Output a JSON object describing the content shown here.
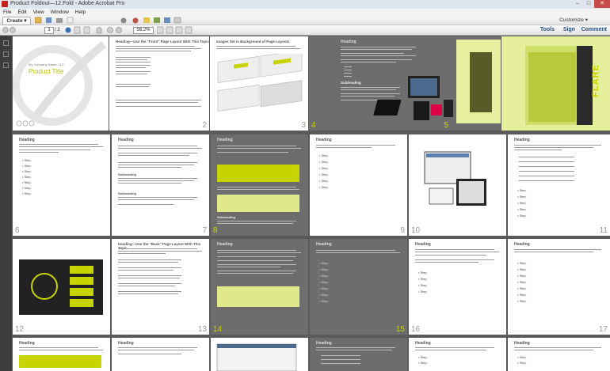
{
  "window": {
    "title": "Product Foldout—12.Fold - Adobe Acrobat Pro",
    "controls": [
      "–",
      "□",
      "✕"
    ]
  },
  "menu": [
    "File",
    "Edit",
    "View",
    "Window",
    "Help"
  ],
  "toolbar": {
    "create_label": "Create",
    "customize_label": "Customize",
    "current_page": "1",
    "total_pages": "/ 2",
    "zoom": "56.2%"
  },
  "right_panel_links": [
    "Tools",
    "Sign",
    "Comment"
  ],
  "pages": {
    "p1": {
      "company": "My Company Name, LLC",
      "product": "Product Title"
    },
    "p2": {
      "heading": "Heading—Use the \"Front\" Page Layout With This Topic",
      "num": "2"
    },
    "p3": {
      "heading": "Images Set in Background of Page Layouts",
      "num": "3"
    },
    "p4": {
      "heading": "Heading",
      "sub": "Subheading",
      "num": "4"
    },
    "p5": {
      "brand": "FLARE",
      "num": "5"
    },
    "p6": {
      "heading": "Heading",
      "num": "6"
    },
    "p7": {
      "heading": "Heading",
      "sub1": "Subheading",
      "sub2": "Subheading",
      "num": "7"
    },
    "p8": {
      "heading": "Heading",
      "sub": "Subheading",
      "num": "8"
    },
    "p9": {
      "heading": "Heading",
      "num": "9"
    },
    "p10": {
      "num": "10"
    },
    "p11": {
      "heading": "Heading",
      "num": "11"
    },
    "p12": {
      "num": "12"
    },
    "p13": {
      "heading": "Heading—Use the \"Back\" Page Layout With This Topic",
      "num": "13"
    },
    "p14": {
      "heading": "Heading",
      "num": "14"
    },
    "p15": {
      "heading": "Heading",
      "num": "15"
    },
    "p16": {
      "heading": "Heading",
      "num": "16"
    },
    "p17": {
      "heading": "Heading",
      "num": "17"
    },
    "row4": [
      "Heading",
      "Heading",
      "Heading",
      "Heading",
      "Heading"
    ]
  },
  "bullets": [
    "Step.",
    "Step.",
    "Step.",
    "Step.",
    "Step.",
    "Step.",
    "Step."
  ],
  "colors": {
    "accent": "#c8d400",
    "gray_page": "#6d6d6d",
    "desk": "#5a5a5a"
  }
}
